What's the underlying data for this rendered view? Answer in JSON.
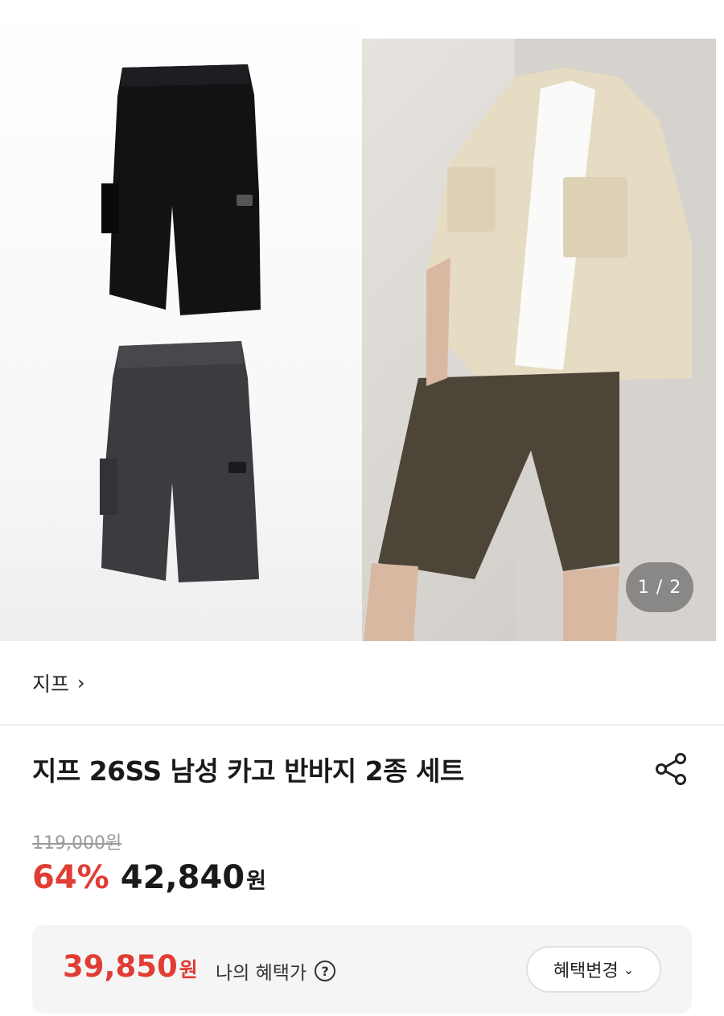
{
  "gallery": {
    "counter": "1 / 2",
    "left_image": "black and charcoal cargo shorts product photo",
    "right_image": "model wearing beige shirt and brown cargo shorts"
  },
  "brand": {
    "name": "지프",
    "chevron": "›"
  },
  "product": {
    "title": "지프 26SS 남성 카고 반바지 2종 세트",
    "original_price": "119,000원",
    "discount": "64%",
    "sale_price": "42,840",
    "currency": "원"
  },
  "benefit": {
    "price": "39,850",
    "currency": "원",
    "label": "나의 혜택가",
    "help": "?",
    "change_button": "혜택변경"
  },
  "icons": {
    "share": "share-icon",
    "help": "help-icon",
    "chevron_right": "chevron-right-icon",
    "chevron_down": "chevron-down-icon"
  },
  "colors": {
    "accent_red": "#e03d34",
    "text": "#1a1a1a",
    "muted": "#9a9a9a",
    "benefit_bg": "#f5f5f5"
  }
}
